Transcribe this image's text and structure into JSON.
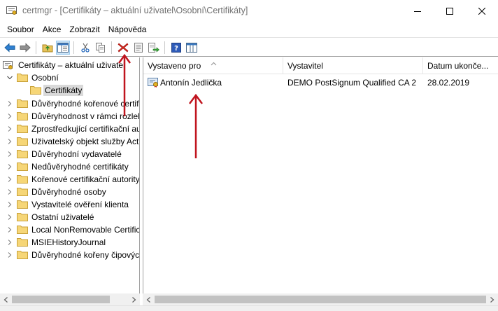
{
  "window": {
    "title": "certmgr - [Certifikáty – aktuální uživatel\\Osobní\\Certifikáty]"
  },
  "menu": [
    "Soubor",
    "Akce",
    "Zobrazit",
    "Nápověda"
  ],
  "toolbar": {
    "icons": [
      "back-icon",
      "forward-icon",
      "up-folder-icon",
      "show-hide-tree-icon",
      "cut-icon",
      "copy-icon",
      "delete-icon",
      "properties-icon",
      "export-icon",
      "help-icon",
      "view-icon"
    ],
    "pressed": "show-hide-tree-icon"
  },
  "tree": {
    "root": "Certifikáty – aktuální uživatel",
    "items": [
      {
        "label": "Osobní",
        "level": 1,
        "expanded": true
      },
      {
        "label": "Certifikáty",
        "level": 2,
        "selected": true
      },
      {
        "label": "Důvěryhodné kořenové certifikační autority",
        "level": 1
      },
      {
        "label": "Důvěryhodnost v rámci rozlehlé sítě",
        "level": 1
      },
      {
        "label": "Zprostředkující certifikační autority",
        "level": 1
      },
      {
        "label": "Uživatelský objekt služby Active Directory",
        "level": 1
      },
      {
        "label": "Důvěryhodní vydavatelé",
        "level": 1
      },
      {
        "label": "Nedůvěryhodné certifikáty",
        "level": 1
      },
      {
        "label": "Kořenové certifikační autority jiných výrobců",
        "level": 1
      },
      {
        "label": "Důvěryhodné osoby",
        "level": 1
      },
      {
        "label": "Vystavitelé ověření klienta",
        "level": 1
      },
      {
        "label": "Ostatní uživatelé",
        "level": 1
      },
      {
        "label": "Local NonRemovable Certificates",
        "level": 1
      },
      {
        "label": "MSIEHistoryJournal",
        "level": 1
      },
      {
        "label": "Důvěryhodné kořeny čipových karet",
        "level": 1
      }
    ]
  },
  "list": {
    "columns": [
      "Vystaveno pro",
      "Vystavitel",
      "Datum ukonče..."
    ],
    "rows": [
      {
        "issued_to": "Antonín Jedlička",
        "issuer": "DEMO PostSignum Qualified CA 2",
        "expires": "28.02.2019"
      }
    ]
  },
  "colors": {
    "annotation_arrow": "#c0141e",
    "selection_bg": "#d9d9d9",
    "toolbar_pressed": "#cce4f7"
  }
}
